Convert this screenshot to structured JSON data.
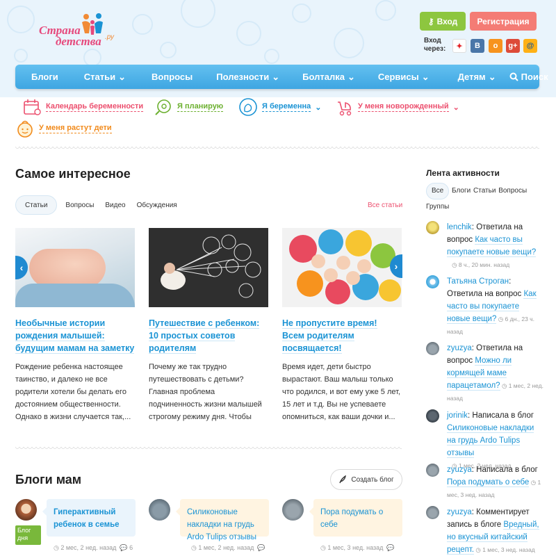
{
  "brand": {
    "line1": "Страна",
    "line2": "детства",
    "suffix": ".ру"
  },
  "auth": {
    "login": "Вход",
    "register": "Регистрация",
    "login_via": "Вход через:"
  },
  "social": [
    {
      "name": "odnoklassniki-icon",
      "glyph": "✦",
      "color": "#ffffff",
      "fg": "#e32227"
    },
    {
      "name": "vk-icon",
      "glyph": "В",
      "color": "#4a76a8",
      "fg": "#ffffff"
    },
    {
      "name": "ok-icon",
      "glyph": "о",
      "color": "#f7931e",
      "fg": "#ffffff"
    },
    {
      "name": "google-plus-icon",
      "glyph": "g+",
      "color": "#dd4b39",
      "fg": "#ffffff"
    },
    {
      "name": "mailru-icon",
      "glyph": "@",
      "color": "#ffb116",
      "fg": "#1a5a9a"
    }
  ],
  "nav": [
    {
      "label": "Блоги",
      "arrow": ""
    },
    {
      "label": "Статьи",
      "arrow": "⌄"
    },
    {
      "label": "Вопросы",
      "arrow": ""
    },
    {
      "label": "Полезности",
      "arrow": "⌄"
    },
    {
      "label": "Болталка",
      "arrow": "⌄"
    },
    {
      "label": "Сервисы",
      "arrow": "⌄"
    },
    {
      "label": "Детям",
      "arrow": "⌄"
    },
    {
      "label": "Поиск",
      "arrow": ""
    }
  ],
  "subnav": [
    {
      "label": "Календарь беременности",
      "color": "#ec4f6e",
      "arrow": ""
    },
    {
      "label": "Я планирую",
      "color": "#6cb02f",
      "arrow": ""
    },
    {
      "label": "Я беременна",
      "color": "#1a93d4",
      "arrow": "⌄"
    },
    {
      "label": "У меня новорожденный",
      "color": "#ec4f6e",
      "arrow": "⌄"
    },
    {
      "label": "У меня растут дети",
      "color": "#f18a1b",
      "arrow": ""
    }
  ],
  "featured": {
    "title": "Самое интересное",
    "tabs": [
      "Статьи",
      "Вопросы",
      "Видео",
      "Обсуждения"
    ],
    "all_link": "Все статьи",
    "cards": [
      {
        "title": "Необычные истории рождения малышей: будущим мамам на заметку",
        "text": "Рождение ребенка настоящее таинство, и далеко не все родители хотели бы делать его достоянием общественности. Однако в жизни случается так,..."
      },
      {
        "title": "Путешествие с ребенком: 10 простых советов родителям",
        "text": "Почему же так трудно путешествовать с детьми? Главная проблема подчиненность жизни малышей строгому режиму дня. Чтобы"
      },
      {
        "title": "Не пропустите время! Всем родителям посвящается!",
        "text": "Время идет, дети быстро вырастают. Ваш малыш только что родился, и вот ему уже 5 лет, 15 лет и т.д. Вы не успеваете опомниться, как ваши дочки и..."
      }
    ]
  },
  "blogs": {
    "title": "Блоги мам",
    "create": "Создать блог",
    "badge": "Блог дня",
    "items": [
      {
        "title": "Гиперактивный ребенок в семье",
        "time": "2 мес, 2 нед. назад",
        "comments": "6",
        "bg": "#eaf4fc"
      },
      {
        "title": "Силиконовые накладки на грудь Ardo Tulips отзывы",
        "time": "1 мес, 2 нед. назад",
        "comments": "",
        "bg": "#fff4e1"
      },
      {
        "title": "Пора подумать о себе",
        "time": "1 мес, 3 нед. назад",
        "comments": "",
        "bg": "#eaf4fc"
      }
    ]
  },
  "activity": {
    "title": "Лента активности",
    "tabs": [
      "Все",
      "Блоги",
      "Статьи",
      "Вопросы",
      "Группы"
    ],
    "items": [
      {
        "user": "lenchik",
        "action": ": Ответила на вопрос ",
        "target": "Как часто вы покупаете новые вещи?",
        "time": " 8 ч., 20 мин. назад"
      },
      {
        "user": "Татьяна Строган",
        "action": ": Ответила на вопрос ",
        "target": "Как часто вы покупаете новые вещи?",
        "time": " 6 дн., 23 ч. назад"
      },
      {
        "user": "zyuzya",
        "action": ": Ответила на вопрос ",
        "target": "Можно ли кормящей маме парацетамол?",
        "time": " 1 мес, 2 нед. назад"
      },
      {
        "user": "jorinik",
        "action": ": Написала в блог ",
        "target": "Силиконовые накладки на грудь Ardo Tulips отзывы",
        "time": " 1 мес, 2 нед. назад"
      },
      {
        "user": "zyuzya",
        "action": ": Написала в блог ",
        "target": "Пора подумать о себе",
        "time": " 1 мес, 3 нед. назад"
      },
      {
        "user": "zyuzya",
        "action": ": Комментирует запись в блоге ",
        "target": "Вредный, но вкусный китайский рецепт.",
        "time": " 1 мес, 3 нед. назад"
      }
    ]
  }
}
